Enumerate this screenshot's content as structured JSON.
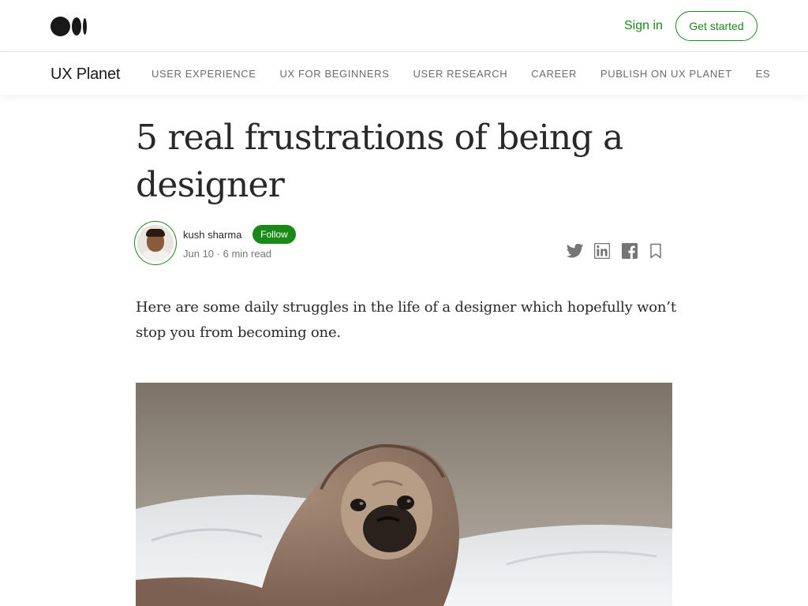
{
  "header": {
    "logo_icon": "medium-logo-icon",
    "signin_label": "Sign in",
    "get_started_label": "Get started",
    "accent_color": "#1a8917"
  },
  "publication": {
    "name": "UX Planet",
    "nav": [
      "USER EXPERIENCE",
      "UX FOR BEGINNERS",
      "USER RESEARCH",
      "CAREER",
      "PUBLISH ON UX PLANET",
      "ES"
    ]
  },
  "article": {
    "title": "5 real frustrations of being a designer",
    "author": {
      "name": "kush sharma",
      "follow_label": "Follow",
      "date": "Jun 10",
      "read_time": "6 min read"
    },
    "share_icons": [
      "twitter-icon",
      "linkedin-icon",
      "facebook-icon",
      "bookmark-icon"
    ],
    "lede": "Here are some daily struggles in the life of a designer which hopefully won’t stop you from becoming one."
  }
}
